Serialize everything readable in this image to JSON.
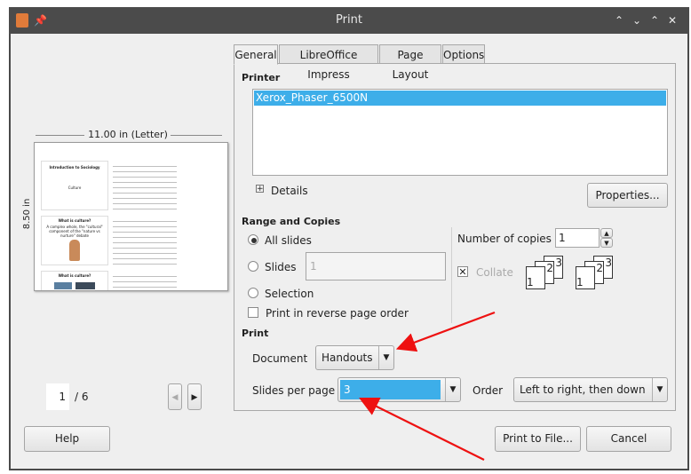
{
  "window": {
    "title": "Print"
  },
  "preview": {
    "paper_label": "11.00 in (Letter)",
    "height_label": "8.50 in",
    "page_current": "1",
    "page_total": "/ 6",
    "slides": [
      {
        "title": "Introduction to Sociology",
        "subtitle": "Culture"
      },
      {
        "title": "What is culture?",
        "bullet": "A complex whole, the \"cultural\" component of the \"nature vs nurture\" debate"
      },
      {
        "title": "What is culture?"
      }
    ]
  },
  "tabs": [
    "General",
    "LibreOffice Impress",
    "Page Layout",
    "Options"
  ],
  "printer": {
    "section": "Printer",
    "selected": "Xerox_Phaser_6500N",
    "details_label": "Details",
    "properties_button": "Properties..."
  },
  "range": {
    "section": "Range and Copies",
    "all_slides": "All slides",
    "slides": "Slides",
    "slides_value": "1",
    "selection": "Selection",
    "reverse_order": "Print in reverse page order",
    "copies_label": "Number of copies",
    "copies_value": "1",
    "collate": "Collate"
  },
  "print": {
    "section": "Print",
    "document_label": "Document",
    "document_value": "Handouts",
    "slides_per_page_label": "Slides per page",
    "slides_per_page_value": "3",
    "order_label": "Order",
    "order_value": "Left to right, then down"
  },
  "buttons": {
    "help": "Help",
    "print_to_file": "Print to File...",
    "cancel": "Cancel"
  },
  "colors": {
    "selection": "#3daee9",
    "annotation_arrow": "#e11111"
  }
}
